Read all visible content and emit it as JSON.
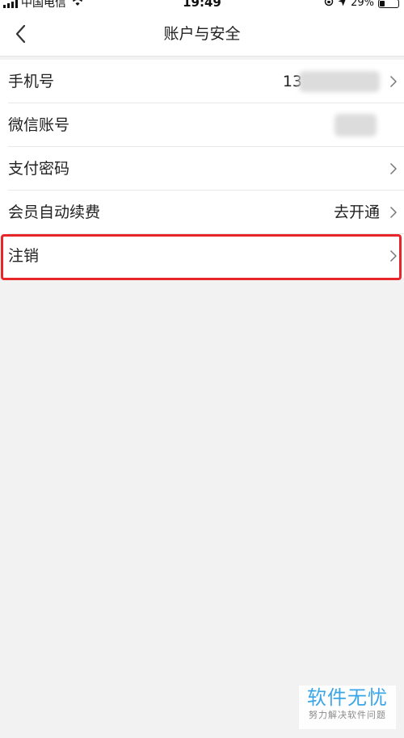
{
  "status_bar": {
    "carrier": "中国电信",
    "time": "19:49",
    "battery": "29%",
    "battery_level": 0.29
  },
  "header": {
    "title": "账户与安全"
  },
  "settings": [
    {
      "label": "手机号",
      "value": "13",
      "value_obscured": true
    },
    {
      "label": "微信账号",
      "value": "",
      "value_obscured": true
    },
    {
      "label": "支付密码",
      "value": ""
    },
    {
      "label": "会员自动续费",
      "value": "去开通"
    },
    {
      "label": "注销",
      "value": "",
      "highlighted": true
    }
  ],
  "watermark": {
    "title": "软件无忧",
    "subtitle": "努力解决软件问题"
  },
  "colors": {
    "highlight": "#e8262a",
    "background": "#f2f2f2",
    "watermark_accent": "#3aa6e8"
  }
}
